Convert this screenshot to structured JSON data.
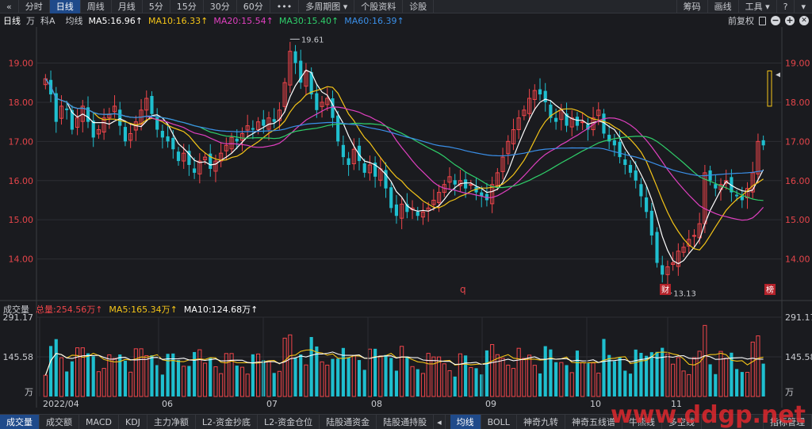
{
  "toolbar": {
    "back_glyph": "«",
    "tabs": [
      "分时",
      "日线",
      "周线",
      "月线",
      "5分",
      "15分",
      "30分",
      "60分",
      "•••",
      "多周期图 ▾",
      "个股资料",
      "诊股"
    ],
    "right_tabs": [
      "筹码",
      "画线",
      "工具 ▾",
      "?",
      "▾"
    ]
  },
  "ma_line": {
    "period": "日线",
    "unit": "万",
    "stock_short": "科A",
    "label": "均线",
    "ma5": "MA5:16.96↑",
    "ma10": "MA10:16.33↑",
    "ma20": "MA20:15.54↑",
    "ma30": "MA30:15.40↑",
    "ma60": "MA60:16.39↑",
    "adjust": "前复权",
    "colors": {
      "ma5": "#ffffff",
      "ma10": "#f5c518",
      "ma20": "#e040c0",
      "ma30": "#2fcf6a",
      "ma60": "#3a8fe8",
      "up": "#f0454a",
      "down": "#1fbfcf"
    }
  },
  "volume_info": {
    "title": "成交量",
    "total": "总量:254.56万↑",
    "ma5": "MA5:165.34万↑",
    "ma10": "MA10:124.68万↑"
  },
  "chart_data": {
    "type": "candlestick",
    "price_axis": {
      "ticks": [
        "19.00",
        "18.00",
        "17.00",
        "16.00",
        "15.00",
        "14.00"
      ],
      "ylim": [
        13.0,
        19.8
      ]
    },
    "volume_axis": {
      "ticks": [
        "291.17",
        "145.58",
        "万"
      ],
      "ylim": [
        0,
        291.17
      ]
    },
    "x_labels": [
      "2022/04",
      "06",
      "07",
      "08",
      "09",
      "10",
      "11"
    ],
    "annotations": {
      "high": "19.61",
      "low": "13.13",
      "marker_q": "q",
      "marker_cai": "财",
      "marker_bang": "榜"
    },
    "closes": [
      18.6,
      18.2,
      17.5,
      17.9,
      17.8,
      17.3,
      17.6,
      17.9,
      17.5,
      17.1,
      17.3,
      17.6,
      17.7,
      17.9,
      17.4,
      17.0,
      17.2,
      17.5,
      17.8,
      18.1,
      17.7,
      17.3,
      17.1,
      17.0,
      16.8,
      16.5,
      16.7,
      16.4,
      16.2,
      16.5,
      16.6,
      16.3,
      16.5,
      16.7,
      16.9,
      17.1,
      17.0,
      17.2,
      17.4,
      17.3,
      17.5,
      17.4,
      17.6,
      17.5,
      17.8,
      18.5,
      19.3,
      19.0,
      18.5,
      18.8,
      18.2,
      17.8,
      18.0,
      18.1,
      17.6,
      17.0,
      16.6,
      16.4,
      16.8,
      16.5,
      16.2,
      16.4,
      16.1,
      16.3,
      15.8,
      15.3,
      15.1,
      15.4,
      15.2,
      15.3,
      15.1,
      15.2,
      15.3,
      15.5,
      15.7,
      15.9,
      16.1,
      15.9,
      16.0,
      15.8,
      15.9,
      15.7,
      15.6,
      15.5,
      15.9,
      16.2,
      16.6,
      17.0,
      17.3,
      17.6,
      17.8,
      18.1,
      18.3,
      18.2,
      18.0,
      17.6,
      17.5,
      17.8,
      17.4,
      17.6,
      17.4,
      17.5,
      17.3,
      17.6,
      17.8,
      17.2,
      17.0,
      16.9,
      16.6,
      16.4,
      16.2,
      16.0,
      15.6,
      15.2,
      14.6,
      13.9,
      13.6,
      13.8,
      13.9,
      14.2,
      14.3,
      14.5,
      14.6,
      14.9,
      16.2,
      16.0,
      15.8,
      15.9,
      16.0,
      15.7,
      15.6,
      15.5,
      15.8,
      16.2,
      17.0,
      16.9
    ],
    "volume_ma_note": "MA5 yellow, MA10 white"
  }
}
